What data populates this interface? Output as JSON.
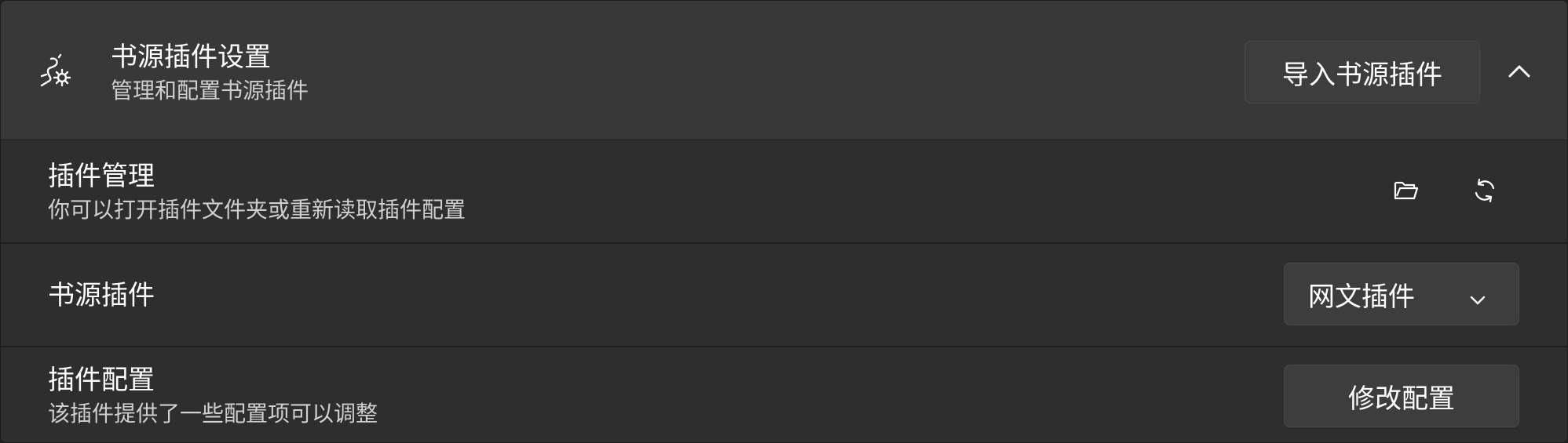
{
  "header": {
    "title": "书源插件设置",
    "subtitle": "管理和配置书源插件",
    "icon": "plugin-settings-icon",
    "import_button_label": "导入书源插件",
    "collapse_icon": "chevron-up-icon"
  },
  "plugin_management": {
    "title": "插件管理",
    "subtitle": "你可以打开插件文件夹或重新读取插件配置",
    "actions": [
      {
        "icon": "folder-open-icon"
      },
      {
        "icon": "refresh-icon"
      }
    ]
  },
  "source_plugin": {
    "title": "书源插件",
    "selected_value": "网文插件",
    "dropdown_icon": "chevron-down-icon"
  },
  "plugin_config": {
    "title": "插件配置",
    "subtitle": "该插件提供了一些配置项可以调整",
    "button_label": "修改配置"
  },
  "colors": {
    "background": "#2e2e2e",
    "header_background": "#383838",
    "button_background": "#3d3d3d",
    "text_primary": "#ffffff",
    "text_secondary": "#cfcfcf"
  }
}
